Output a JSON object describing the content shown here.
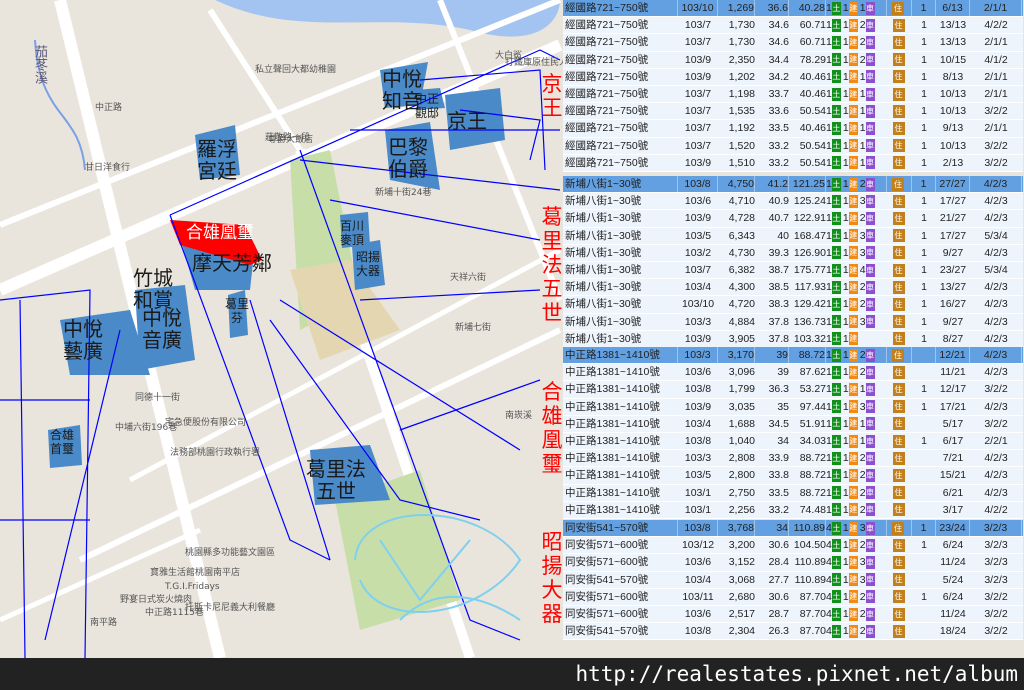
{
  "map": {
    "blocks": [
      {
        "label": "羅浮\n宮廷"
      },
      {
        "label": "中悅\n知音"
      },
      {
        "label": "京王"
      },
      {
        "label": "巴黎\n伯爵"
      },
      {
        "label": "摩天芳鄰"
      },
      {
        "label": "竹城\n和賞"
      },
      {
        "label": "中悅\n音廣"
      },
      {
        "label": "中悅\n藝廣"
      },
      {
        "label": "合雄\n首璽"
      },
      {
        "label": "葛里法\n五世"
      },
      {
        "label": "百川\n麥頂"
      },
      {
        "label": "昭揚\n大器"
      },
      {
        "label": "中正\n觀邸"
      },
      {
        "label": "葛里\n芬"
      }
    ],
    "highlight": {
      "label": "合雄凰璽",
      "color": "#ff0000"
    },
    "side_labels": [
      "京王",
      "葛里法五世",
      "合雄凰璽",
      "昭揚大器"
    ],
    "places": [
      "茄苳溪",
      "中正路",
      "莊敬路一段",
      "私立聲回大都幼稚園",
      "尊爵大飯店",
      "甘日洋食行",
      "新埔十街24巷",
      "天祥六街",
      "新埔七街",
      "同德十一街",
      "中埔六街196巷",
      "宅急便股份有限公司",
      "法務部桃園行政執行署",
      "桃園縣多功能藝文園區",
      "寶雅生活館桃園南平店",
      "T.G.I.Fridays",
      "野宴日式炭火燒肉",
      "中正路1115巷",
      "托斯卡尼尼義大利餐廳",
      "南平路",
      "大白鯊",
      "打鐵庫原住民人文主題餐廳",
      "南崁溪"
    ],
    "colors": {
      "block": "#4a8ac8",
      "outline": "#0000ff",
      "road": "#ffffff",
      "water": "#a3c4f0",
      "park": "#c8dea8"
    }
  },
  "table": {
    "groups": [
      {
        "rows": [
          [
            "經國路721~750號",
            "103/10",
            "1,269",
            "36.6",
            "40.28",
            "1",
            "1",
            "1",
            "",
            "1",
            "6/13",
            "2/1/1"
          ],
          [
            "經國路721~750號",
            "103/7",
            "1,730",
            "34.6",
            "60.71",
            "1",
            "1",
            "2",
            "",
            "1",
            "13/13",
            "4/2/2"
          ],
          [
            "經國路721~750號",
            "103/7",
            "1,730",
            "34.6",
            "60.71",
            "1",
            "1",
            "2",
            "",
            "1",
            "13/13",
            "2/1/1"
          ],
          [
            "經國路721~750號",
            "103/9",
            "2,350",
            "34.4",
            "78.29",
            "1",
            "1",
            "2",
            "",
            "1",
            "10/15",
            "4/1/2"
          ],
          [
            "經國路721~750號",
            "103/9",
            "1,202",
            "34.2",
            "40.46",
            "1",
            "1",
            "1",
            "",
            "1",
            "8/13",
            "2/1/1"
          ],
          [
            "經國路721~750號",
            "103/7",
            "1,198",
            "33.7",
            "40.46",
            "1",
            "1",
            "1",
            "",
            "1",
            "10/13",
            "2/1/1"
          ],
          [
            "經國路721~750號",
            "103/7",
            "1,535",
            "33.6",
            "50.54",
            "1",
            "1",
            "1",
            "",
            "1",
            "10/13",
            "3/2/2"
          ],
          [
            "經國路721~750號",
            "103/7",
            "1,192",
            "33.5",
            "40.46",
            "1",
            "1",
            "1",
            "",
            "1",
            "9/13",
            "2/1/1"
          ],
          [
            "經國路721~750號",
            "103/7",
            "1,520",
            "33.2",
            "50.54",
            "1",
            "1",
            "1",
            "",
            "1",
            "10/13",
            "3/2/2"
          ],
          [
            "經國路721~750號",
            "103/9",
            "1,510",
            "33.2",
            "50.54",
            "1",
            "1",
            "1",
            "",
            "1",
            "2/13",
            "3/2/2"
          ]
        ]
      },
      {
        "rows": [
          [
            "新埔八街1~30號",
            "103/8",
            "4,750",
            "41.2",
            "121.25",
            "1",
            "1",
            "2",
            "",
            "1",
            "27/27",
            "4/2/3"
          ],
          [
            "新埔八街1~30號",
            "103/6",
            "4,710",
            "40.9",
            "125.24",
            "1",
            "1",
            "3",
            "",
            "1",
            "17/27",
            "4/2/3"
          ],
          [
            "新埔八街1~30號",
            "103/9",
            "4,728",
            "40.7",
            "122.91",
            "1",
            "1",
            "2",
            "",
            "1",
            "21/27",
            "4/2/3"
          ],
          [
            "新埔八街1~30號",
            "103/5",
            "6,343",
            "40",
            "168.47",
            "1",
            "1",
            "3",
            "",
            "1",
            "17/27",
            "5/3/4"
          ],
          [
            "新埔八街1~30號",
            "103/2",
            "4,730",
            "39.3",
            "126.90",
            "1",
            "1",
            "3",
            "",
            "1",
            "9/27",
            "4/2/3"
          ],
          [
            "新埔八街1~30號",
            "103/7",
            "6,382",
            "38.7",
            "175.77",
            "1",
            "1",
            "4",
            "",
            "1",
            "23/27",
            "5/3/4"
          ],
          [
            "新埔八街1~30號",
            "103/4",
            "4,300",
            "38.5",
            "117.93",
            "1",
            "1",
            "2",
            "",
            "1",
            "13/27",
            "4/2/3"
          ],
          [
            "新埔八街1~30號",
            "103/10",
            "4,720",
            "38.3",
            "129.42",
            "1",
            "1",
            "2",
            "",
            "1",
            "16/27",
            "4/2/3"
          ],
          [
            "新埔八街1~30號",
            "103/3",
            "4,884",
            "37.8",
            "136.73",
            "1",
            "1",
            "3",
            "",
            "1",
            "9/27",
            "4/2/3"
          ],
          [
            "新埔八街1~30號",
            "103/9",
            "3,905",
            "37.8",
            "103.32",
            "1",
            "1",
            "",
            "",
            "1",
            "8/27",
            "4/2/3"
          ]
        ]
      },
      {
        "rows": [
          [
            "中正路1381~1410號",
            "103/3",
            "3,170",
            "39",
            "88.72",
            "1",
            "1",
            "2",
            "",
            "",
            "12/21",
            "4/2/3"
          ],
          [
            "中正路1381~1410號",
            "103/6",
            "3,096",
            "39",
            "87.62",
            "1",
            "1",
            "2",
            "",
            "",
            "11/21",
            "4/2/3"
          ],
          [
            "中正路1381~1410號",
            "103/8",
            "1,799",
            "36.3",
            "53.27",
            "1",
            "1",
            "1",
            "",
            "1",
            "12/17",
            "3/2/2"
          ],
          [
            "中正路1381~1410號",
            "103/9",
            "3,035",
            "35",
            "97.44",
            "1",
            "1",
            "3",
            "",
            "1",
            "17/21",
            "4/2/3"
          ],
          [
            "中正路1381~1410號",
            "103/4",
            "1,688",
            "34.5",
            "51.91",
            "1",
            "1",
            "1",
            "",
            "",
            "5/17",
            "3/2/2"
          ],
          [
            "中正路1381~1410號",
            "103/8",
            "1,040",
            "34",
            "34.03",
            "1",
            "1",
            "1",
            "",
            "1",
            "6/17",
            "2/2/1"
          ],
          [
            "中正路1381~1410號",
            "103/3",
            "2,808",
            "33.9",
            "88.72",
            "1",
            "1",
            "2",
            "",
            "",
            "7/21",
            "4/2/3"
          ],
          [
            "中正路1381~1410號",
            "103/5",
            "2,800",
            "33.8",
            "88.72",
            "1",
            "1",
            "2",
            "",
            "",
            "15/21",
            "4/2/3"
          ],
          [
            "中正路1381~1410號",
            "103/1",
            "2,750",
            "33.5",
            "88.72",
            "1",
            "1",
            "2",
            "",
            "",
            "6/21",
            "4/2/3"
          ],
          [
            "中正路1381~1410號",
            "103/1",
            "2,256",
            "33.2",
            "74.48",
            "1",
            "1",
            "2",
            "",
            "",
            "3/17",
            "4/2/2"
          ]
        ]
      },
      {
        "rows": [
          [
            "同安街541~570號",
            "103/8",
            "3,768",
            "34",
            "110.89",
            "4",
            "1",
            "3",
            "",
            "1",
            "23/24",
            "3/2/3"
          ],
          [
            "同安街571~600號",
            "103/12",
            "3,200",
            "30.6",
            "104.50",
            "4",
            "1",
            "2",
            "",
            "1",
            "6/24",
            "3/2/3"
          ],
          [
            "同安街571~600號",
            "103/6",
            "3,152",
            "28.4",
            "110.89",
            "4",
            "1",
            "3",
            "",
            "",
            "11/24",
            "3/2/3"
          ],
          [
            "同安街541~570號",
            "103/4",
            "3,068",
            "27.7",
            "110.89",
            "4",
            "1",
            "3",
            "",
            "",
            "5/24",
            "3/2/3"
          ],
          [
            "同安街571~600號",
            "103/11",
            "2,680",
            "30.6",
            "87.70",
            "4",
            "1",
            "2",
            "",
            "1",
            "6/24",
            "3/2/2"
          ],
          [
            "同安街571~600號",
            "103/6",
            "2,517",
            "28.7",
            "87.70",
            "4",
            "1",
            "2",
            "",
            "",
            "11/24",
            "3/2/2"
          ],
          [
            "同安街541~570號",
            "103/8",
            "2,304",
            "26.3",
            "87.70",
            "4",
            "1",
            "2",
            "",
            "",
            "18/24",
            "3/2/2"
          ]
        ]
      }
    ],
    "badges": {
      "land": "土",
      "build": "建",
      "car": "車",
      "use": "住"
    },
    "colors": {
      "row": "#eef4fc",
      "selected": "#62a0e2",
      "land": "#11901c",
      "build": "#f28a12",
      "car": "#8b4fd0",
      "use": "#c2801c"
    }
  },
  "footer": {
    "url": "http://realestates.pixnet.net/album"
  }
}
